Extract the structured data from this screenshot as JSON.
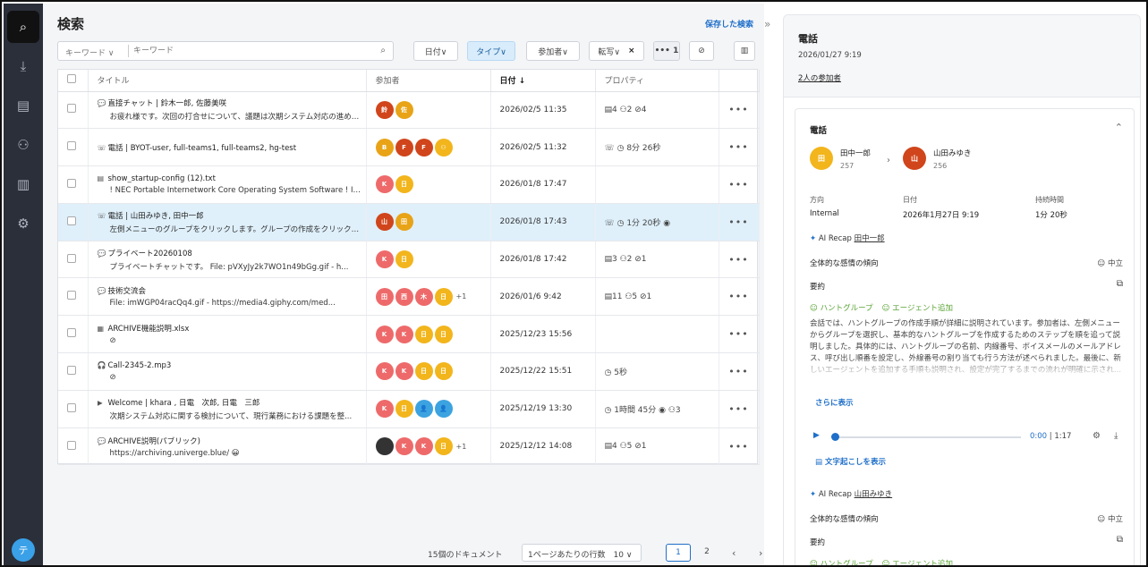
{
  "nav": {
    "avatar_initial": "テ"
  },
  "main": {
    "title": "検索",
    "saved_search": "保存した検索",
    "collapse": "»"
  },
  "toolbar": {
    "keyword_dropdown": "キーワード ∨",
    "keyword_placeholder": "キーワード",
    "date": "日付∨",
    "type": "タイプ∨",
    "participants": "参加者∨",
    "transfer": "転写∨",
    "transfer_clear": "×",
    "more_filters": "••• 1"
  },
  "table": {
    "headers": {
      "title": "タイトル",
      "participants": "参加者",
      "date": "日付 ↓",
      "properties": "プロパティ"
    },
    "rows": [
      {
        "icon": "💬",
        "title": "直接チャット | 鈴木一郎, 佐藤美咲",
        "subtitle": "お疲れ様です。次回の打合せについて、議題は次期システム対応の進め方...",
        "avatars": [
          {
            "c": "r",
            "t": "鈴"
          },
          {
            "c": "o",
            "t": "佐"
          }
        ],
        "more": "",
        "date": "2026/02/5 11:35",
        "props": "▤4 ⚇2 ⊘4"
      },
      {
        "icon": "☏",
        "title": "電話 | BYOT-user, full-teams1, full-teams2, hg-test",
        "subtitle": "",
        "avatars": [
          {
            "c": "o",
            "t": "B"
          },
          {
            "c": "r",
            "t": "F"
          },
          {
            "c": "r",
            "t": "F"
          },
          {
            "c": "y",
            "t": "⚇"
          }
        ],
        "more": "",
        "date": "2026/02/5 11:32",
        "props": "☏ ◷ 8分 26秒"
      },
      {
        "icon": "▤",
        "title": "show_startup-config (12).txt",
        "subtitle": "! NEC Portable Internetwork Core Operating System Software ! IX Serie...",
        "avatars": [
          {
            "c": "p",
            "t": "K"
          },
          {
            "c": "y",
            "t": "日"
          }
        ],
        "more": "",
        "date": "2026/01/8 17:47",
        "props": ""
      },
      {
        "icon": "☏",
        "title": "電話 | 山田みゆき, 田中一郎",
        "subtitle": "左側メニューのグループをクリックします。グループの作成をクリックしま...",
        "avatars": [
          {
            "c": "r",
            "t": "山"
          },
          {
            "c": "o",
            "t": "田"
          }
        ],
        "more": "",
        "date": "2026/01/8 17:43",
        "props": "☏ ◷ 1分 20秒 ◉"
      },
      {
        "icon": "💬",
        "title": "プライベート20260108",
        "subtitle": "プライベートチャットです。 File: pVXyJy2k7WO1n49bGg.gif - h...",
        "avatars": [
          {
            "c": "p",
            "t": "K"
          },
          {
            "c": "y",
            "t": "日"
          }
        ],
        "more": "",
        "date": "2026/01/8 17:42",
        "props": "▤3 ⚇2 ⊘1"
      },
      {
        "icon": "💬",
        "title": "技術交流会",
        "subtitle": "File: imWGP04racQq4.gif - https://media4.giphy.com/med...",
        "avatars": [
          {
            "c": "p",
            "t": "田"
          },
          {
            "c": "p",
            "t": "西"
          },
          {
            "c": "p",
            "t": "木"
          },
          {
            "c": "y",
            "t": "日"
          }
        ],
        "more": "+1",
        "date": "2026/01/6 9:42",
        "props": "▤11 ⚇5 ⊘1"
      },
      {
        "icon": "▦",
        "title": "ARCHIVE機能説明.xlsx",
        "subtitle": "⊘",
        "avatars": [
          {
            "c": "p",
            "t": "K"
          },
          {
            "c": "p",
            "t": "K"
          },
          {
            "c": "y",
            "t": "日"
          },
          {
            "c": "y",
            "t": "日"
          }
        ],
        "more": "",
        "date": "2025/12/23 15:56",
        "props": ""
      },
      {
        "icon": "🎧",
        "title": "Call-2345-2.mp3",
        "subtitle": "⊘",
        "avatars": [
          {
            "c": "p",
            "t": "K"
          },
          {
            "c": "p",
            "t": "K"
          },
          {
            "c": "y",
            "t": "日"
          },
          {
            "c": "y",
            "t": "日"
          }
        ],
        "more": "",
        "date": "2025/12/22 15:51",
        "props": "◷ 5秒"
      },
      {
        "icon": "▶",
        "title": "Welcome | khara , 日電　次郎, 日電　三郎",
        "subtitle": "次期システム対応に関する検討について、現行業務における課題を整...",
        "avatars": [
          {
            "c": "p",
            "t": "K"
          },
          {
            "c": "y",
            "t": "日"
          },
          {
            "c": "b",
            "t": "👤"
          },
          {
            "c": "b",
            "t": "👤"
          }
        ],
        "more": "",
        "date": "2025/12/19 13:30",
        "props": "◷ 1時間 45分 ◉ ⚇3"
      },
      {
        "icon": "💬",
        "title": "ARCHIVE説明(パブリック)",
        "subtitle": "https://archiving.univerge.blue/ 😀",
        "avatars": [
          {
            "c": "k",
            "t": ""
          },
          {
            "c": "p",
            "t": "K"
          },
          {
            "c": "p",
            "t": "K"
          },
          {
            "c": "y",
            "t": "日"
          }
        ],
        "more": "+1",
        "date": "2025/12/12 14:08",
        "props": "▤4 ⚇5 ⊘1"
      }
    ]
  },
  "footer": {
    "doc_count": "15個のドキュメント",
    "rows_per_page": "1ページあたりの行数　10 ∨",
    "page1": "1",
    "page2": "2",
    "prev": "‹",
    "next": "›"
  },
  "panel": {
    "title": "電話",
    "datetime": "2026/01/27 9:19",
    "participants_link": "2人の参加者",
    "card": {
      "title": "電話",
      "caller": {
        "initial": "田",
        "name": "田中一郎",
        "ext": "257"
      },
      "callee": {
        "initial": "山",
        "name": "山田みゆき",
        "ext": "256"
      },
      "direction_label": "方向",
      "direction": "Internal",
      "date_label": "日付",
      "date": "2026年1月27日 9:19",
      "duration_label": "持続時間",
      "duration": "1分 20秒",
      "recap1_label": "AI Recap",
      "recap1_name": "田中一郎",
      "sentiment_label": "全体的な感情の傾向",
      "sentiment_value": "☺ 中立",
      "summary_label": "要約",
      "tag1": "ハントグループ",
      "tag2": "エージェント追加",
      "summary_text": "会話では、ハントグループの作成手順が詳細に説明されています。参加者は、左側メニューからグループを選択し、基本的なハントグループを作成するためのステップを順を追って説明しました。具体的には、ハントグループの名前、内線番号、ボイスメールのメールアドレス、呼び出し順番を設定し、外線番号の割り当ても行う方法が述べられました。最後に、新しいエージェントを追加する手順も説明され、設定が完了するまでの流れが明確に示され...",
      "show_more": "さらに表示",
      "time_current": "0:00",
      "time_total": "| 1:17",
      "transcript_link": "文字起こしを表示",
      "recap2_label": "AI Recap",
      "recap2_name": "山田みゆき",
      "sentiment2_label": "全体的な感情の傾向",
      "sentiment2_value": "☺ 中立",
      "summary2_label": "要約",
      "tag3": "ハントグループ",
      "tag4": "エージェント追加"
    }
  }
}
